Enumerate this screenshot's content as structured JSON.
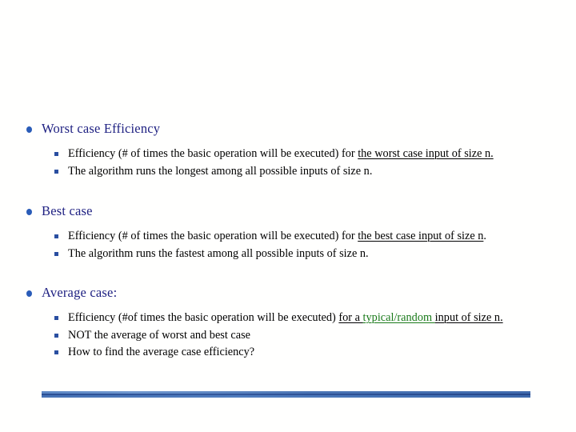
{
  "slide": {
    "title_topic": "Worst case Efficiency",
    "accent_heading_color": "#1f2182",
    "bullet_color": "#2a5cb8",
    "sub_bullet_color": "#2a4fa0",
    "highlight_color": "#1a7a1a",
    "background_color": "#fffffe",
    "divider_color": "#2b4f94"
  },
  "groups": [
    {
      "heading": "Worst case Efficiency",
      "items": [
        {
          "run1": "Efficiency (# of times the basic operation will be executed) for ",
          "run2": "the worst case input of size n.",
          "run3": ""
        },
        {
          "run1": "The algorithm runs the longest among all possible inputs of size n.",
          "run2": "",
          "run3": ""
        }
      ]
    },
    {
      "heading": "Best case",
      "items": [
        {
          "run1": "Efficiency (# of times the basic operation will be executed) for ",
          "run2": "the best case input of size n",
          "run3": "."
        },
        {
          "run1": "The algorithm runs the fastest among all possible inputs of size n.",
          "run2": "",
          "run3": ""
        }
      ]
    },
    {
      "heading": "Average case:",
      "items": [
        {
          "run1": "Efficiency (#of times the basic operation will be executed) ",
          "run2": "for a ",
          "run3": "typical/random ",
          "run4": "input of size n."
        },
        {
          "run1": "NOT the average of worst and best case",
          "run2": "",
          "run3": ""
        },
        {
          "run1": "How to find the average case efficiency?",
          "run2": "",
          "run3": ""
        }
      ]
    }
  ]
}
